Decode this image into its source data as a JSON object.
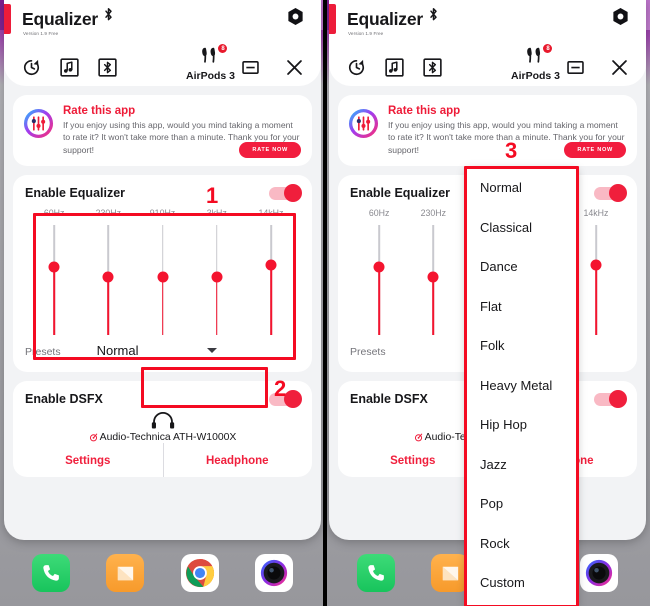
{
  "app": {
    "title": "Equalizer",
    "version": "Version 1.9 Free",
    "bluetooth_icon": "bluetooth-icon",
    "settings_icon": "hexagon-settings-icon"
  },
  "toolbar": {
    "icons": [
      {
        "name": "history-refresh-icon",
        "glyph": "history"
      },
      {
        "name": "music-note-icon",
        "glyph": "music"
      },
      {
        "name": "bluetooth-box-icon",
        "glyph": "bluetooth"
      }
    ],
    "device_name": "AirPods 3",
    "device_badge": "8",
    "minimize_label": "minimize-icon",
    "close_label": "close-icon"
  },
  "rate_card": {
    "title": "Rate this app",
    "text": "If you enjoy using this app, would you mind taking a moment to rate it? It won't take more than a minute. Thank you for your support!",
    "button_label": "RATE NOW"
  },
  "equalizer": {
    "title": "Enable Equalizer",
    "enabled": true,
    "bands": [
      {
        "label": "60Hz",
        "thumb_pct": 38
      },
      {
        "label": "230Hz",
        "thumb_pct": 47
      },
      {
        "label": "910Hz",
        "thumb_pct": 47
      },
      {
        "label": "3kHz",
        "thumb_pct": 47
      },
      {
        "label": "14kHz",
        "thumb_pct": 36
      }
    ],
    "presets_label": "Presets",
    "preset_selected": "Normal",
    "preset_options": [
      "Normal",
      "Classical",
      "Dance",
      "Flat",
      "Folk",
      "Heavy Metal",
      "Hip Hop",
      "Jazz",
      "Pop",
      "Rock",
      "Custom"
    ]
  },
  "dsfx": {
    "title": "Enable DSFX",
    "enabled": true,
    "headphone_name": "Audio-Technica ATH-W1000X",
    "settings_label": "Settings",
    "headphone_label": "Headphone"
  },
  "dock": {
    "items": [
      {
        "name": "phone-app-icon",
        "label": "Phone"
      },
      {
        "name": "messages-app-icon",
        "label": "Messages"
      },
      {
        "name": "chrome-app-icon",
        "label": "Chrome"
      },
      {
        "name": "camera-app-icon",
        "label": "Camera"
      }
    ]
  },
  "annotations": {
    "one": "1",
    "two": "2",
    "three": "3",
    "accent": "#f40b22"
  }
}
